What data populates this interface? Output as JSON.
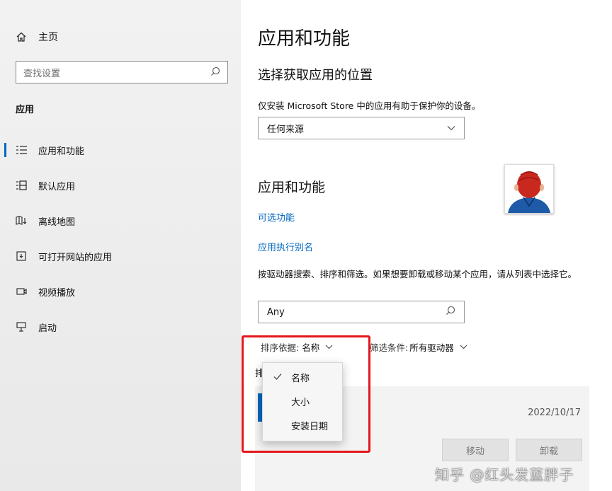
{
  "sidebar": {
    "home_label": "主页",
    "search_placeholder": "查找设置",
    "section_title": "应用",
    "items": [
      {
        "label": "应用和功能",
        "icon": "apps-features-icon"
      },
      {
        "label": "默认应用",
        "icon": "default-apps-icon"
      },
      {
        "label": "离线地图",
        "icon": "offline-maps-icon"
      },
      {
        "label": "可打开网站的应用",
        "icon": "apps-for-websites-icon"
      },
      {
        "label": "视频播放",
        "icon": "video-playback-icon"
      },
      {
        "label": "启动",
        "icon": "startup-icon"
      }
    ],
    "active_index": 0
  },
  "main": {
    "page_title": "应用和功能",
    "choose_heading": "选择获取应用的位置",
    "choose_desc": "仅安装 Microsoft Store 中的应用有助于保护你的设备。",
    "source_select_value": "任何来源",
    "section_heading": "应用和功能",
    "link_optional": "可选功能",
    "link_alias": "应用执行别名",
    "search_desc": "按驱动器搜索、排序和筛选。如果想要卸载或移动某个应用，请从列表中选择它。",
    "search_value": "Any",
    "sort_label": "排序依据:",
    "sort_value": "名称",
    "filter_label": "筛选条件:",
    "filter_value": "所有驱动器",
    "partial_text": "排",
    "app_date": "2022/10/17",
    "move_button": "移动",
    "uninstall_button": "卸载"
  },
  "sort_menu": {
    "options": [
      "名称",
      "大小",
      "安装日期"
    ],
    "selected_index": 0
  },
  "watermark": "知乎 @红头发蓝胖子",
  "colors": {
    "accent": "#0067c0",
    "highlight_box": "#e4161b",
    "sidebar_bg": "#f2f2f2"
  }
}
